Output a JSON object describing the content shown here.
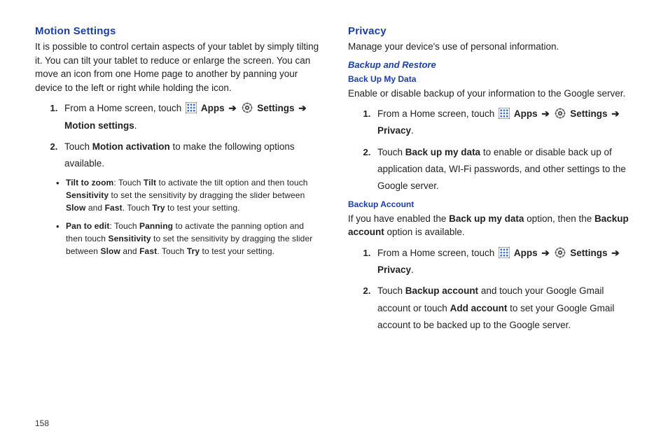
{
  "pageNumber": "158",
  "left": {
    "heading": "Motion Settings",
    "intro": "It is possible to control certain aspects of your tablet by simply tilting it. You can tilt your tablet to reduce or enlarge the screen. You can move an icon from one Home page to another by panning your device to the left or right while holding the icon.",
    "step1_pre": "From a Home screen, touch ",
    "apps": "Apps",
    "settings": "Settings",
    "arrow": "➔",
    "step1_dest": "Motion settings",
    "step2_pre": "Touch ",
    "step2_bold": "Motion activation",
    "step2_post": " to make the following options available.",
    "bullet1_title": "Tilt to zoom",
    "bullet1_a": ": Touch ",
    "bullet1_tilt": "Tilt",
    "bullet1_b": " to activate the tilt option and then touch ",
    "bullet1_sens": "Sensitivity",
    "bullet1_c": " to set the sensitivity by dragging the slider between ",
    "bullet1_slow": "Slow",
    "bullet1_and": " and ",
    "bullet1_fast": "Fast",
    "bullet1_d": ". Touch ",
    "bullet1_try": "Try",
    "bullet1_e": " to test your setting.",
    "bullet2_title": "Pan to edit",
    "bullet2_a": ": Touch ",
    "bullet2_pan": "Panning",
    "bullet2_b": " to activate the panning option and then touch ",
    "bullet2_sens": "Sensitivity",
    "bullet2_c": " to set the sensitivity by dragging the slider between ",
    "bullet2_slow": "Slow",
    "bullet2_and": " and ",
    "bullet2_fast": "Fast",
    "bullet2_d": ". Touch ",
    "bullet2_try": "Try",
    "bullet2_e": " to test your setting."
  },
  "right": {
    "heading": "Privacy",
    "intro": "Manage your device's use of personal information.",
    "sub_italic": "Backup and Restore",
    "sub1": "Back Up My Data",
    "backup_intro": "Enable or disable backup of your information to the Google server.",
    "step1_pre": "From a Home screen, touch ",
    "apps": "Apps",
    "settings": "Settings",
    "arrow": "➔",
    "step1_dest": "Privacy",
    "step2_pre": "Touch ",
    "step2_bold": "Back up my data",
    "step2_post": " to enable or disable back up of application data, WI-Fi passwords, and other settings to the Google server.",
    "sub2": "Backup Account",
    "ba_intro_a": "If you have enabled the ",
    "ba_intro_bold1": "Back up my data",
    "ba_intro_b": " option, then the ",
    "ba_intro_bold2": "Backup account",
    "ba_intro_c": " option is available.",
    "ba_step2_pre": "Touch ",
    "ba_step2_bold1": "Backup account",
    "ba_step2_mid": " and touch your Google Gmail account or touch ",
    "ba_step2_bold2": "Add account",
    "ba_step2_post": " to set your Google Gmail account to be backed up to the Google server."
  }
}
